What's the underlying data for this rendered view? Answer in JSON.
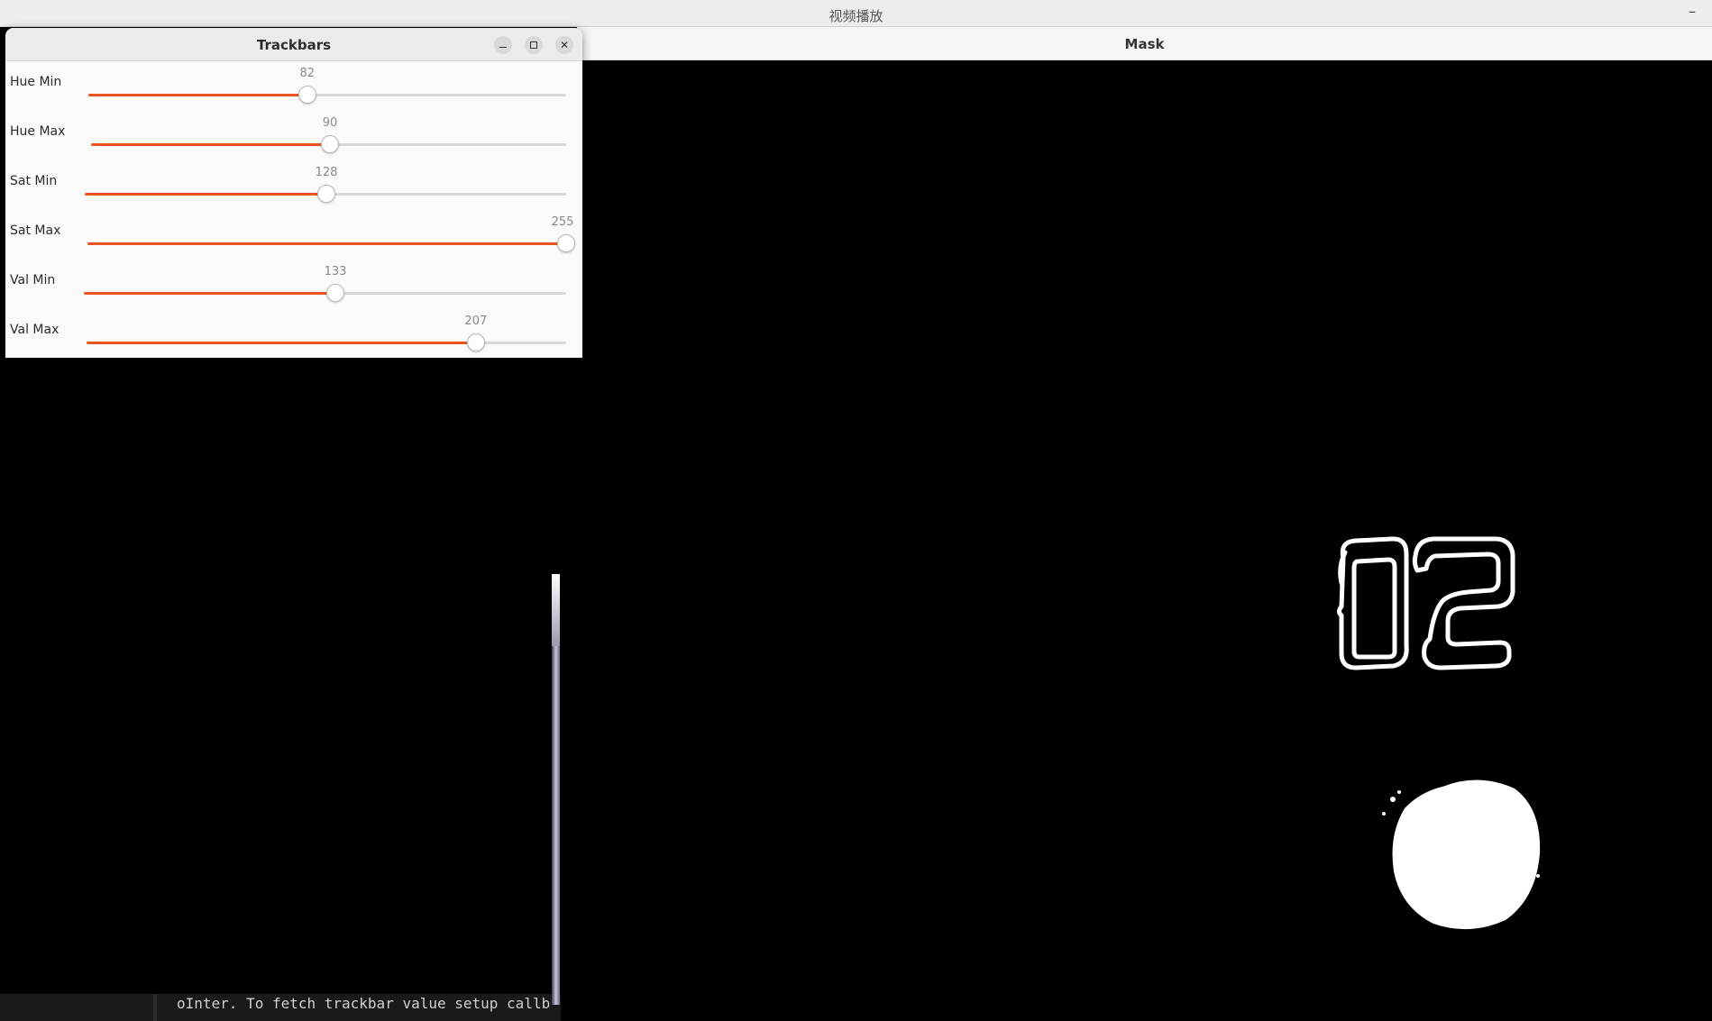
{
  "video_window": {
    "title": "视频播放",
    "minimize_label": "–"
  },
  "mask_window": {
    "title": "Mask"
  },
  "trackbars_window": {
    "title": "Trackbars",
    "minimize_label": "–",
    "maximize_label": "□",
    "close_label": "✕",
    "accent_color": "#e95420",
    "sliders": [
      {
        "label": "Hue Min",
        "value": "82",
        "max": 179
      },
      {
        "label": "Hue Max",
        "value": "90",
        "max": 179
      },
      {
        "label": "Sat Min",
        "value": "128",
        "max": 255
      },
      {
        "label": "Sat Max",
        "value": "255",
        "max": 255
      },
      {
        "label": "Val Min",
        "value": "133",
        "max": 255
      },
      {
        "label": "Val Max",
        "value": "207",
        "max": 255
      }
    ]
  },
  "terminal": {
    "line1": "oInter. To fetch trackbar value setup callb",
    "line2": "..."
  }
}
